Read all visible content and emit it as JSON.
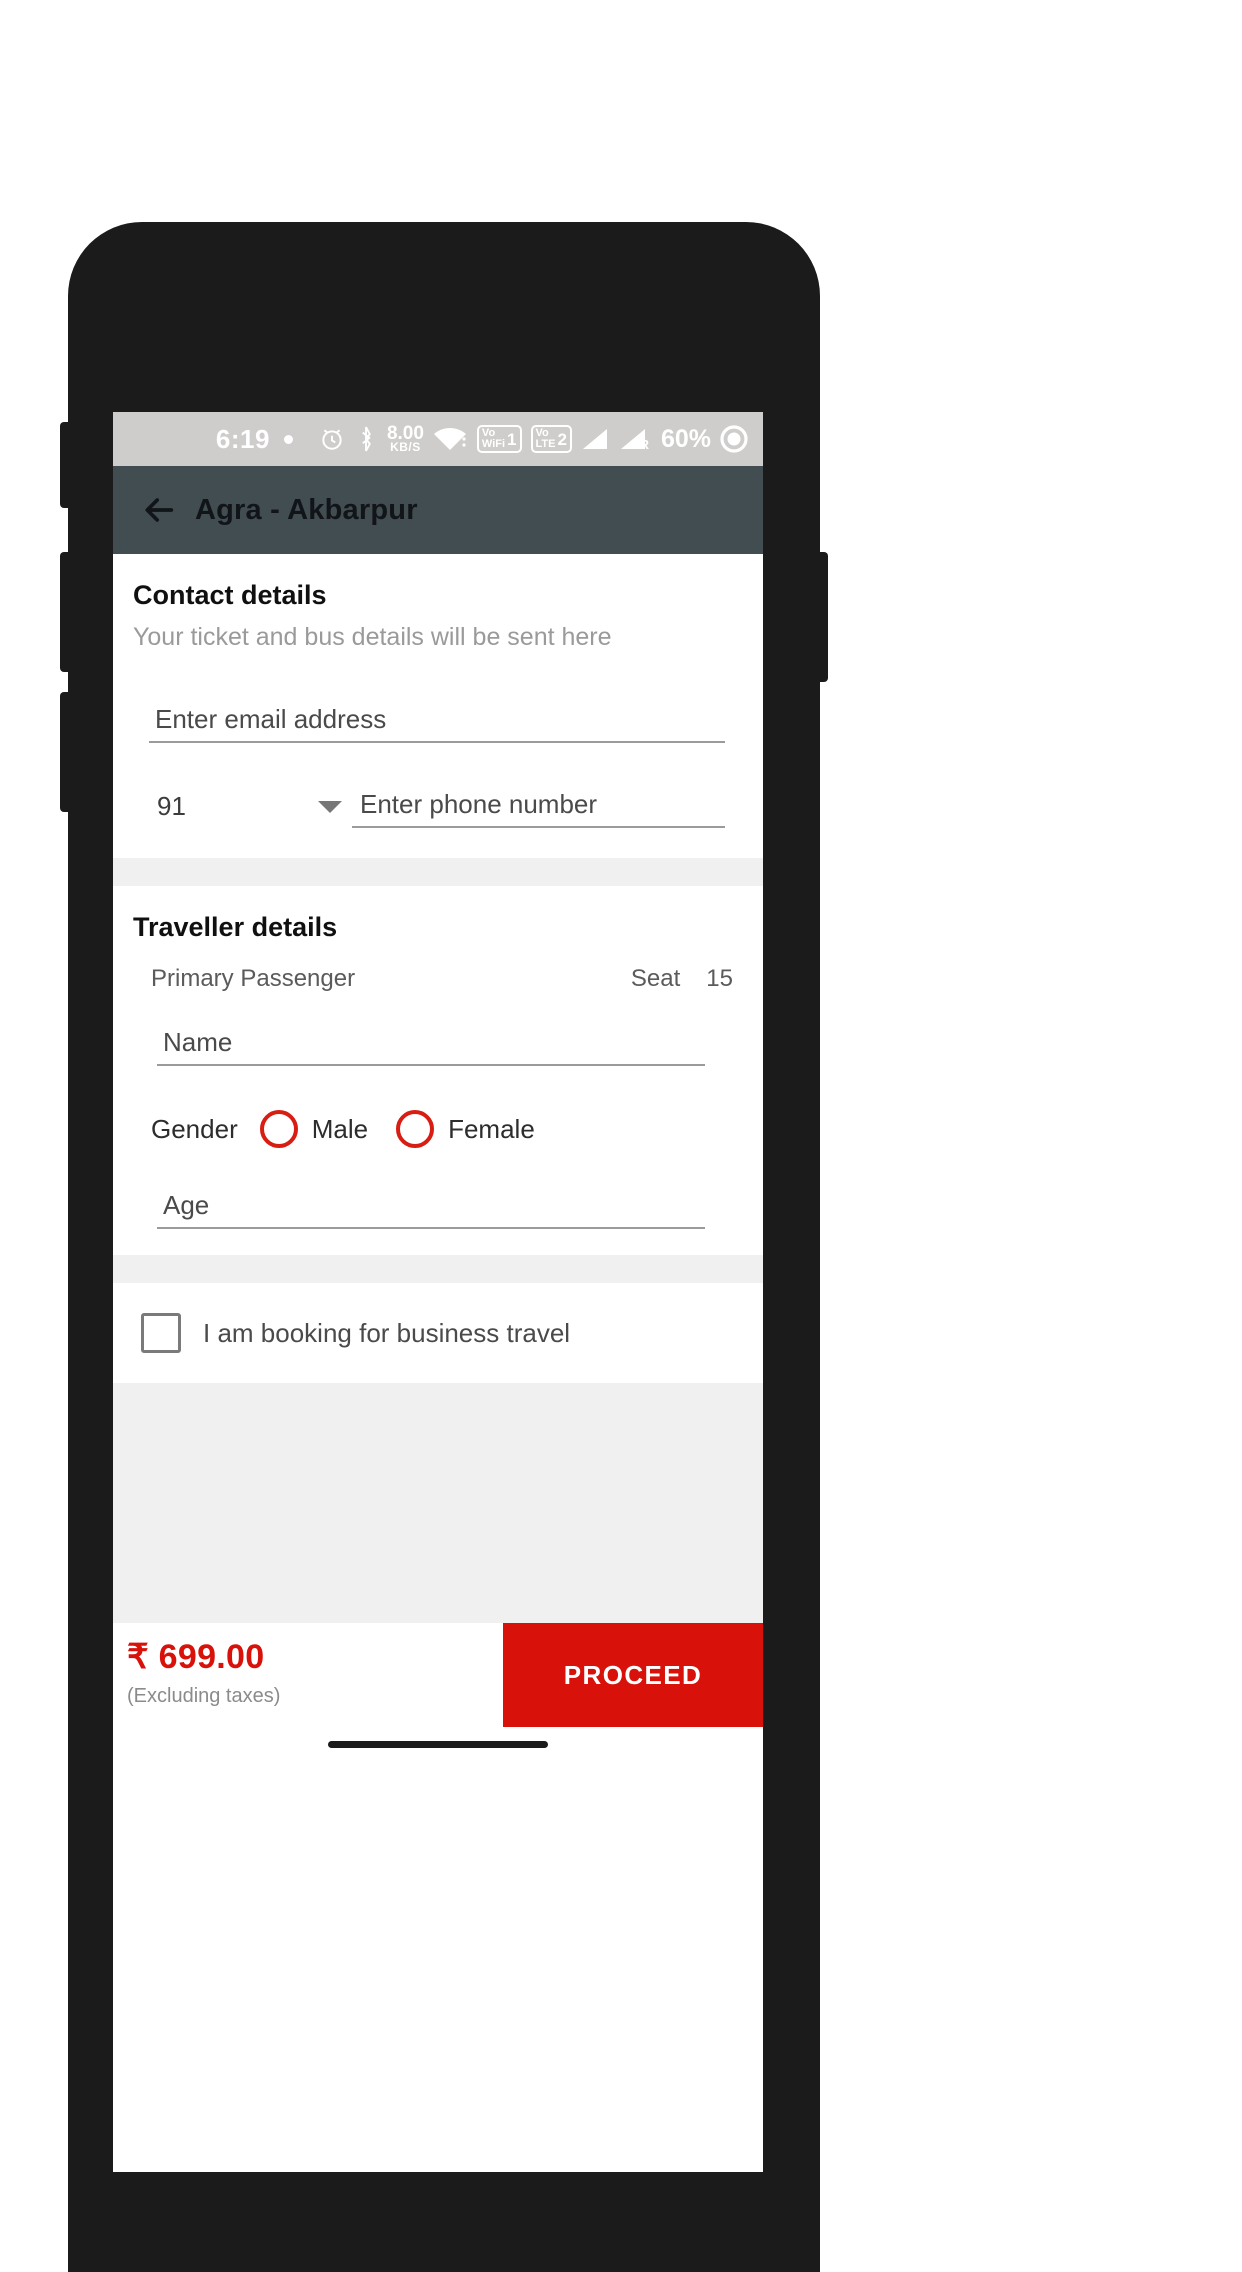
{
  "status_bar": {
    "clock": "6:19",
    "network_rate_value": "8.00",
    "network_rate_unit": "KB/S",
    "volte_wifi_label_top": "Vo",
    "volte_wifi_label_bottom": "WiFi",
    "sim1_number": "1",
    "volte_label_top": "Vo",
    "volte_label_bottom": "LTE",
    "sim2_number": "2",
    "roaming_label": "R",
    "battery": "60%",
    "icons": [
      "alarm-icon",
      "bluetooth-icon",
      "wifi-icon",
      "volte-wifi-icon",
      "volte-icon",
      "signal-icon",
      "signal-roaming-icon",
      "battery-icon"
    ]
  },
  "app_bar": {
    "back_icon": "back-arrow-icon",
    "title": "Agra - Akbarpur"
  },
  "contact": {
    "title": "Contact details",
    "subtitle": "Your ticket and bus details will be sent here",
    "email_placeholder": "Enter email address",
    "email_value": "",
    "country_code": "91",
    "phone_placeholder": "Enter phone number",
    "phone_value": ""
  },
  "traveller": {
    "title": "Traveller details",
    "passenger_label": "Primary Passenger",
    "seat_label": "Seat",
    "seat_number": "15",
    "name_placeholder": "Name",
    "name_value": "",
    "gender_label": "Gender",
    "gender_options": [
      "Male",
      "Female"
    ],
    "age_placeholder": "Age",
    "age_value": ""
  },
  "business": {
    "label": "I am booking for business travel",
    "checked": false
  },
  "bottom": {
    "fare": "₹ 699.00",
    "fare_note": "(Excluding taxes)",
    "proceed_label": "PROCEED"
  },
  "colors": {
    "accent_red": "#d8120b",
    "app_bar": "#414d51",
    "status_bar": "#cfcdcb",
    "divider_gray": "#f0f0f0"
  }
}
